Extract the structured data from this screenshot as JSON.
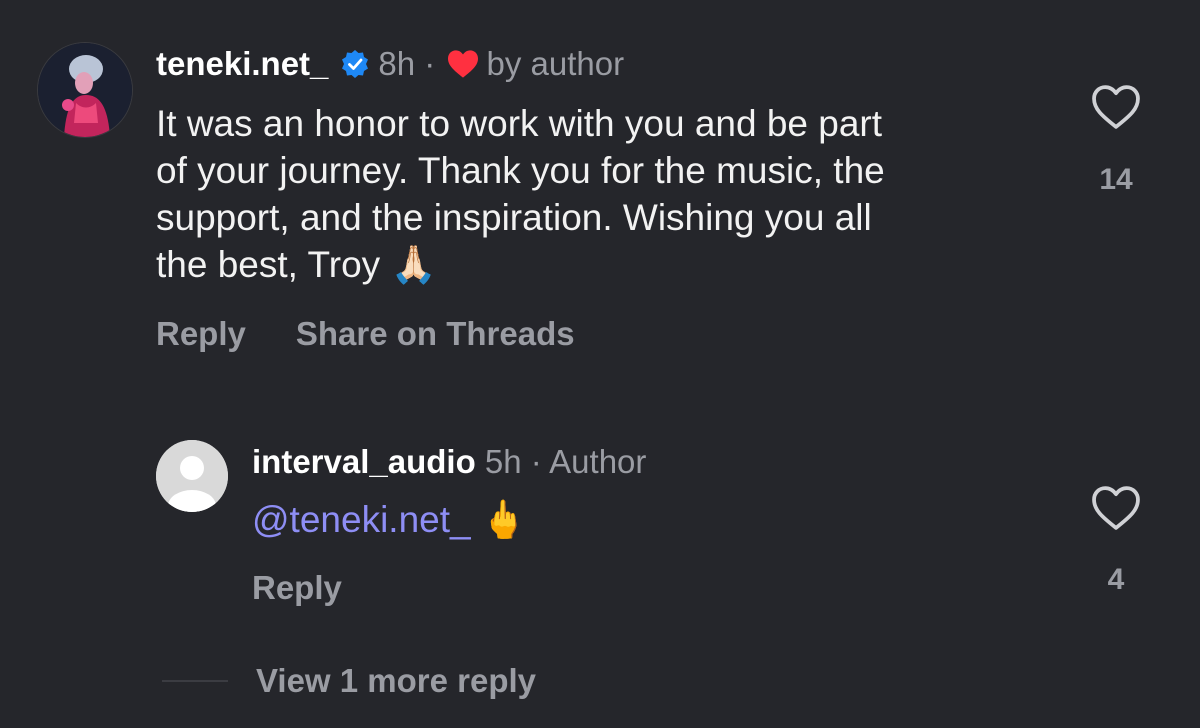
{
  "comment": {
    "username": "teneki.net_",
    "time": "8h",
    "separator": "·",
    "liked_by_label": "by author",
    "text_line1": "It was an honor to work with you and be part",
    "text_line2": "of your journey. Thank you for the music, the",
    "text_line3": "support, and the inspiration. Wishing you all",
    "text_line4": "the best, Troy",
    "emoji": "🙏🏻",
    "reply_label": "Reply",
    "share_label": "Share on Threads",
    "like_count": "14"
  },
  "reply": {
    "username": "interval_audio",
    "time": "5h",
    "separator": "·",
    "role": "Author",
    "mention": "@teneki.net_",
    "emoji": "🖕",
    "reply_label": "Reply",
    "like_count": "4"
  },
  "more_replies_label": "View 1 more reply",
  "colors": {
    "background": "#25262b",
    "text": "#f5f5f5",
    "muted": "#9a9ca3",
    "verified": "#1e88f5",
    "heart": "#ff3040",
    "mention": "#8e8ef5"
  }
}
